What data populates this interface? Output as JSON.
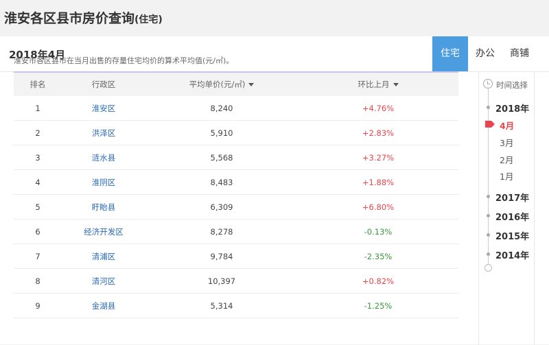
{
  "page": {
    "title": "淮安各区县市房价查询",
    "title_suffix": "(住宅)"
  },
  "header": {
    "period": "2018年4月",
    "tabs": [
      {
        "label": "住宅",
        "active": true
      },
      {
        "label": "办公",
        "active": false
      },
      {
        "label": "商铺",
        "active": false
      }
    ]
  },
  "note": "淮安市各区县市在当月出售的存量住宅均价的算术平均值(元/㎡)。",
  "table": {
    "columns": [
      "排名",
      "行政区",
      "平均单价(元/㎡)",
      "环比上月"
    ],
    "rows": [
      {
        "rank": "1",
        "region": "淮安区",
        "price": "8,240",
        "change": "+4.76%"
      },
      {
        "rank": "2",
        "region": "洪泽区",
        "price": "5,910",
        "change": "+2.83%"
      },
      {
        "rank": "3",
        "region": "涟水县",
        "price": "5,568",
        "change": "+3.27%"
      },
      {
        "rank": "4",
        "region": "淮阴区",
        "price": "8,483",
        "change": "+1.88%"
      },
      {
        "rank": "5",
        "region": "盱眙县",
        "price": "6,309",
        "change": "+6.80%"
      },
      {
        "rank": "6",
        "region": "经济开发区",
        "price": "8,278",
        "change": "-0.13%"
      },
      {
        "rank": "7",
        "region": "清浦区",
        "price": "9,784",
        "change": "-2.35%"
      },
      {
        "rank": "8",
        "region": "清河区",
        "price": "10,397",
        "change": "+0.82%"
      },
      {
        "rank": "9",
        "region": "金湖县",
        "price": "5,314",
        "change": "-1.25%"
      }
    ]
  },
  "timeline": {
    "header": "时间选择",
    "year_2018": "2018年",
    "months": [
      "4月",
      "3月",
      "2月",
      "1月"
    ],
    "active_month": "4月",
    "other_years": [
      "2017年",
      "2016年",
      "2015年",
      "2014年"
    ]
  },
  "colors": {
    "accent": "#4b9ddf",
    "up": "#e8464e",
    "down": "#3a9a3a",
    "region_link": "#2a6ab8"
  }
}
